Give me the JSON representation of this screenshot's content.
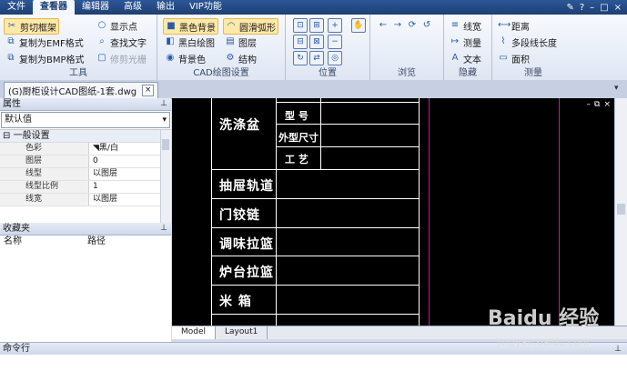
{
  "menubar": {
    "items": [
      {
        "label": "文件"
      },
      {
        "label": "查看器"
      },
      {
        "label": "编辑器"
      },
      {
        "label": "高级"
      },
      {
        "label": "输出"
      },
      {
        "label": "VIP功能"
      }
    ]
  },
  "ribbon": {
    "tools": {
      "caption": "工具",
      "crop_frame": "剪切框架",
      "copy_emf": "复制为EMF格式",
      "copy_bmp": "复制为BMP格式",
      "show_points": "显示点",
      "find_text": "查找文字",
      "trim_raster": "修剪光栅"
    },
    "cad_settings": {
      "caption": "CAD绘图设置",
      "black_bg": "黑色背景",
      "bw_drawing": "黑白绘图",
      "bg_color": "背景色",
      "smooth_arc": "圆滑弧形",
      "layers": "图层",
      "structure": "结构"
    },
    "position": {
      "caption": "位置"
    },
    "browse": {
      "caption": "浏览"
    },
    "hide": {
      "caption": "隐藏",
      "linewidth": "线宽",
      "measure": "测量",
      "text": "文本"
    },
    "measure": {
      "caption": "测量",
      "distance": "距离",
      "polyline_length": "多段线长度",
      "area": "面积"
    }
  },
  "document": {
    "tab_title": "(G)厨柜设计CAD图纸-1套.dwg",
    "close_glyph": "×"
  },
  "properties": {
    "title": "属性",
    "selected": "默认值",
    "section": "一般设置",
    "rows": [
      {
        "key": "色彩",
        "value": "黑/白"
      },
      {
        "key": "图层",
        "value": "0"
      },
      {
        "key": "线型",
        "value": "以图层"
      },
      {
        "key": "线型比例",
        "value": "1"
      },
      {
        "key": "线宽",
        "value": "以图层"
      }
    ]
  },
  "favorites": {
    "title": "收藏夹",
    "col_name": "名称",
    "col_path": "路径"
  },
  "drawing": {
    "labels": [
      "洗涤盆",
      "抽屉轨道",
      "门铰链",
      "调味拉篮",
      "炉台拉篮",
      "米 箱"
    ],
    "sub_labels": [
      "型 号",
      "外型尺寸",
      "工 艺"
    ]
  },
  "layout_tabs": [
    "Model",
    "Layout1"
  ],
  "command": {
    "title": "命令行"
  },
  "watermark": {
    "brand": "Baidu 经验",
    "url": "jingyan.baidu.com"
  }
}
